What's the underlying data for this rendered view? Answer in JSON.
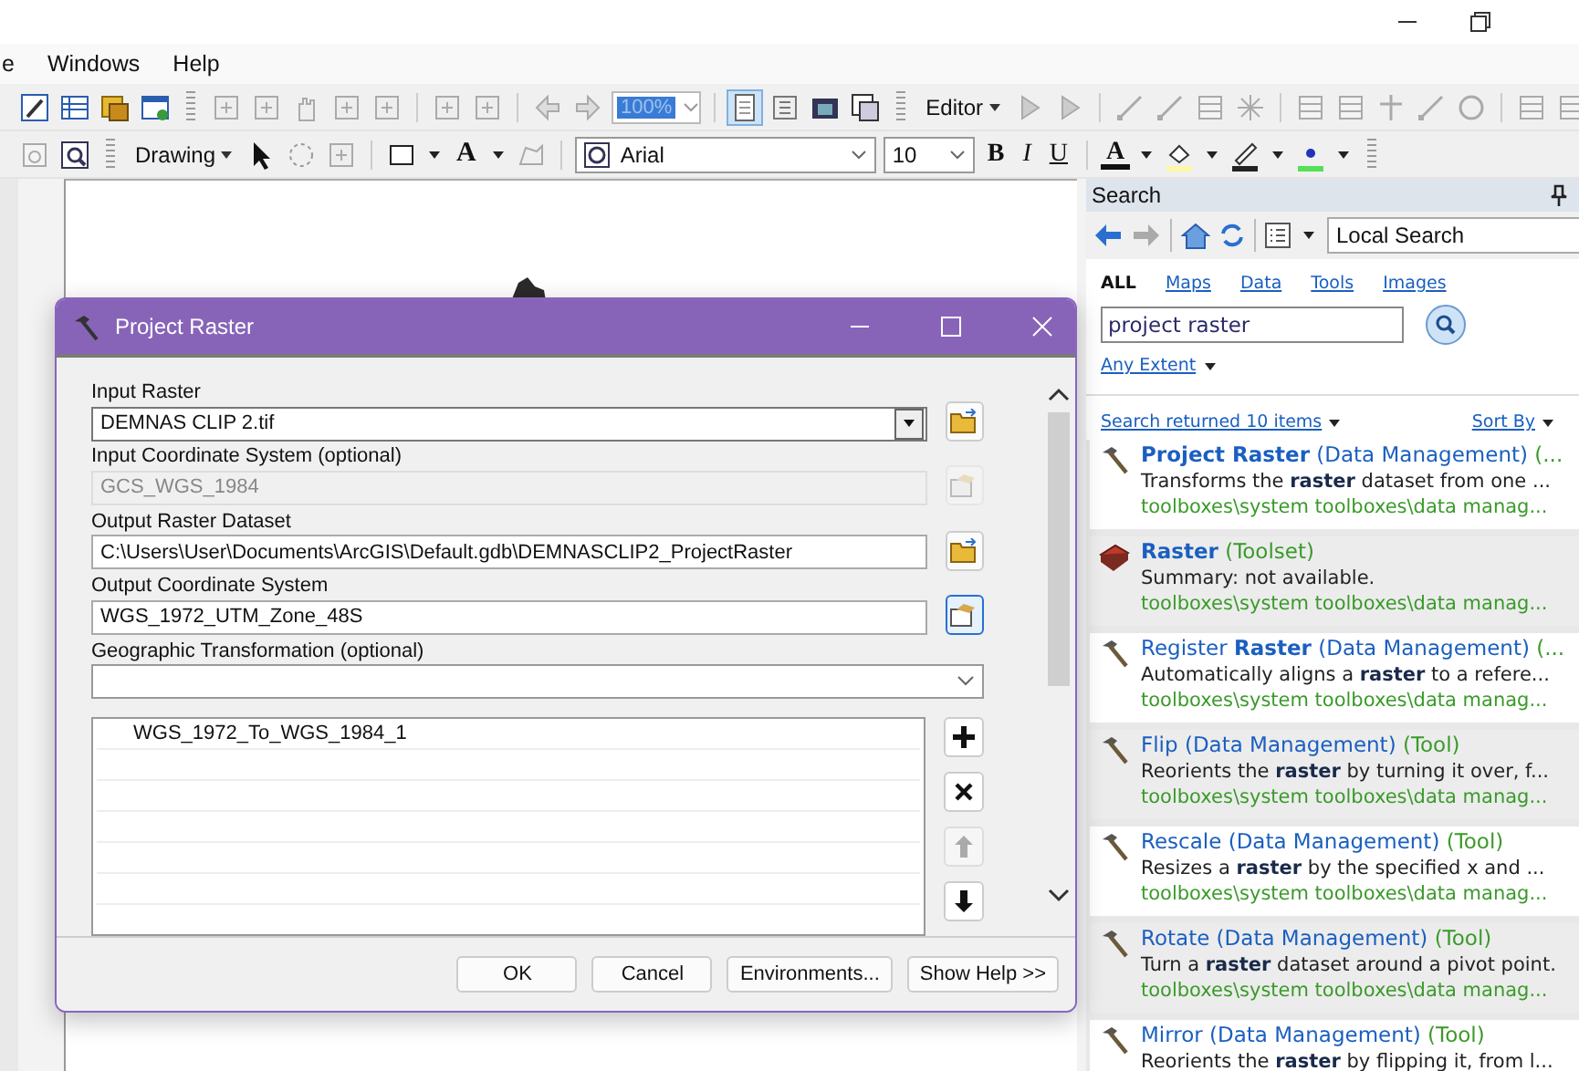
{
  "menu": [
    "e",
    "Windows",
    "Help"
  ],
  "toolbar": {
    "zoom_value": "100%",
    "editor_menu": "Editor",
    "drawing_menu": "Drawing",
    "text_tool": "A",
    "font": "Arial",
    "font_size": "10",
    "styles": [
      {
        "label": "B",
        "kind": "bold"
      },
      {
        "label": "I",
        "kind": "italic"
      },
      {
        "label": "U",
        "kind": "underline"
      }
    ],
    "font_color": "A"
  },
  "dialog": {
    "title": "Project Raster",
    "fields": [
      {
        "label": "Input Raster",
        "kind": "combo",
        "value": "DEMNAS CLIP 2.tif",
        "disabled": false,
        "button": {
          "kind": "browse",
          "focused": false
        }
      },
      {
        "label": "Input Coordinate System (optional)",
        "kind": "text",
        "value": "GCS_WGS_1984",
        "disabled": true,
        "button": {
          "kind": "coordinate",
          "focused": false
        }
      },
      {
        "label": "Output Raster Dataset",
        "kind": "text",
        "value": "C:\\Users\\User\\Documents\\ArcGIS\\Default.gdb\\DEMNASCLIP2_ProjectRaster",
        "disabled": false,
        "button": {
          "kind": "browse",
          "focused": false
        }
      },
      {
        "label": "Output Coordinate System",
        "kind": "text",
        "value": "WGS_1972_UTM_Zone_48S",
        "disabled": false,
        "button": {
          "kind": "coordinate",
          "focused": true
        }
      },
      {
        "label": "Geographic Transformation (optional)",
        "kind": "dropdown",
        "disabled": false
      }
    ],
    "transformations": [
      "WGS_1972_To_WGS_1984_1"
    ],
    "list_buttons": [
      {
        "kind": "add",
        "disabled": false
      },
      {
        "kind": "remove",
        "disabled": false
      },
      {
        "kind": "up",
        "disabled": true
      },
      {
        "kind": "down",
        "disabled": false
      }
    ],
    "buttons": [
      "OK",
      "Cancel",
      "Environments...",
      "Show Help >>"
    ]
  },
  "search_panel": {
    "title": "Search",
    "scope": "Local Search",
    "tabs": [
      {
        "label": "ALL",
        "selected": true
      },
      {
        "label": "Maps",
        "selected": false
      },
      {
        "label": "Data",
        "selected": false
      },
      {
        "label": "Tools",
        "selected": false
      },
      {
        "label": "Images",
        "selected": false
      }
    ],
    "query": "project raster",
    "extent": "Any Extent",
    "summary": "Search returned 10 items",
    "sort": "Sort By",
    "results": [
      {
        "kind": "tool",
        "name": "**Project Raster** (Data Management)",
        "type": "(...",
        "description": "Transforms the **raster** dataset from one ...",
        "path": "toolboxes\\system toolboxes\\data manag..."
      },
      {
        "kind": "toolset",
        "name": "**Raster**",
        "type": "(Toolset)",
        "description": "Summary: not available.",
        "path": "toolboxes\\system toolboxes\\data manag..."
      },
      {
        "kind": "tool",
        "name": "Register **Raster** (Data Management)",
        "type": "(...",
        "description": "Automatically aligns a **raster** to a refere...",
        "path": "toolboxes\\system toolboxes\\data manag..."
      },
      {
        "kind": "tool",
        "name": "Flip (Data Management)",
        "type": "(Tool)",
        "description": "Reorients the **raster** by turning it over, f...",
        "path": "toolboxes\\system toolboxes\\data manag..."
      },
      {
        "kind": "tool",
        "name": "Rescale (Data Management)",
        "type": "(Tool)",
        "description": "Resizes a **raster** by the specified x and ...",
        "path": "toolboxes\\system toolboxes\\data manag..."
      },
      {
        "kind": "tool",
        "name": "Rotate (Data Management)",
        "type": "(Tool)",
        "description": "Turn a **raster** dataset around a pivot point.",
        "path": "toolboxes\\system toolboxes\\data manag..."
      },
      {
        "kind": "tool",
        "name": "Mirror (Data Management)",
        "type": "(Tool)",
        "description": "Reorients the **raster** by flipping it, from l..."
      }
    ]
  }
}
